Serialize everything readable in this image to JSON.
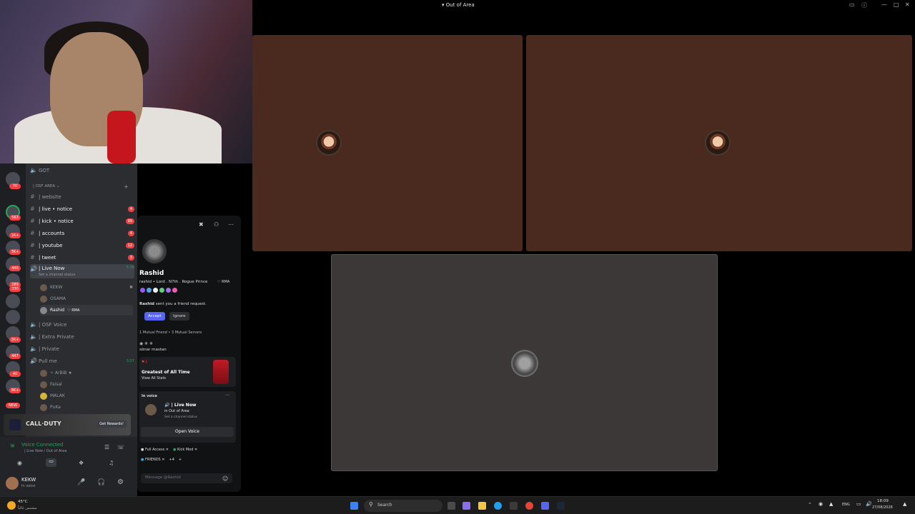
{
  "window": {
    "title": "Out of Area",
    "title_icon": "speaker-icon"
  },
  "channels": {
    "top_channel": "GOT",
    "category": "| OSF AREA",
    "items": [
      {
        "name": "| website",
        "badge": ""
      },
      {
        "name": "| live • notice",
        "badge": "4"
      },
      {
        "name": "| kick • notice",
        "badge": "99"
      },
      {
        "name": "| accounts",
        "badge": "4"
      },
      {
        "name": "| youtube",
        "badge": "12"
      },
      {
        "name": "| tweet",
        "badge": "3"
      }
    ],
    "live_now": {
      "name": "| Live Now",
      "time": "5:36",
      "status": "Set a channel status"
    },
    "voice_users": [
      "KEKW",
      "OSAMA",
      "Rashid"
    ],
    "rashid_tag": "RMA",
    "more_channels": [
      "| OSF Voice",
      "| Extra Private",
      "| Private"
    ],
    "pull_me": {
      "name": "Pull me",
      "time": "3:57"
    },
    "pull_users": [
      "✧ ArBiB ★",
      "Faisal",
      "MALAK",
      "PuKa"
    ]
  },
  "promo": {
    "brand": "CALL·DUTY",
    "button": "Get Rewards!"
  },
  "voice": {
    "status": "Voice Connected",
    "location": "| Live Now / Out of Area"
  },
  "user": {
    "name": "KEKW",
    "status": "In voice"
  },
  "profile": {
    "name": "Rashid",
    "tagline": "rashid • Lord . N7th . Rogue Prince",
    "tag": "RMA",
    "friend_request_name": "Rashid",
    "friend_request_text": "sent you a friend request.",
    "accept": "Accept",
    "ignore": "Ignore",
    "mutual": "1 Mutual Friend • 3 Mutual Servers",
    "bio": "sönar mastan",
    "activity_title": "Greatest of All Time",
    "activity_sub": "View All Stats",
    "in_voice_label": "In voice",
    "in_voice_channel": "| Live Now",
    "in_voice_server": "in Out of Area",
    "in_voice_status": "Set a channel status",
    "open_voice": "Open Voice",
    "roles": [
      "Full Access",
      "Kick Mod",
      "FRIENDS"
    ],
    "roles_more": "+4",
    "message_placeholder": "Message @Rashid"
  },
  "taskbar": {
    "weather_temp": "45°C",
    "weather_desc": "مشمس غالباً",
    "search": "Search",
    "lang": "ENG",
    "time": "18:09",
    "date": "27/08/2026"
  },
  "server_badges": [
    "70",
    "563",
    "1K+",
    "3K+",
    "446",
    "289",
    "230",
    "3K+",
    "447",
    "40",
    "9K+",
    "NEW"
  ]
}
